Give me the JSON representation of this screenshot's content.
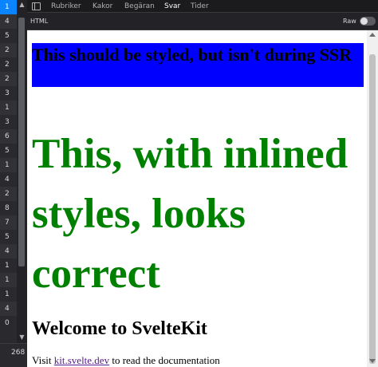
{
  "tabs": [
    {
      "label": "Rubriker"
    },
    {
      "label": "Kakor"
    },
    {
      "label": "Begäran"
    },
    {
      "label": "Svar",
      "active": true
    },
    {
      "label": "Tider"
    }
  ],
  "format_bar": {
    "label": "HTML",
    "raw_label": "Raw",
    "raw_enabled": false
  },
  "request_list": {
    "rows": [
      "1",
      "4",
      "5",
      "2",
      "2",
      "2",
      "3",
      "1",
      "3",
      "6",
      "5",
      "1",
      "4",
      "2",
      "8",
      "7",
      "5",
      "4",
      "1",
      "1",
      "1",
      "4",
      "0"
    ],
    "footer_text": "268"
  },
  "preview": {
    "styled_block": "This should be styled, but isn't during SSR",
    "inline_heading": "This, with inlined styles, looks correct",
    "welcome_heading": "Welcome to SvelteKit",
    "visit_prefix": "Visit ",
    "visit_link": "kit.svelte.dev",
    "visit_suffix": " to read the documentation"
  },
  "colors": {
    "styled_block_bg": "#0000ff",
    "inline_heading": "#008000",
    "selected_row": "#0a84ff",
    "link": "#551a8b"
  }
}
